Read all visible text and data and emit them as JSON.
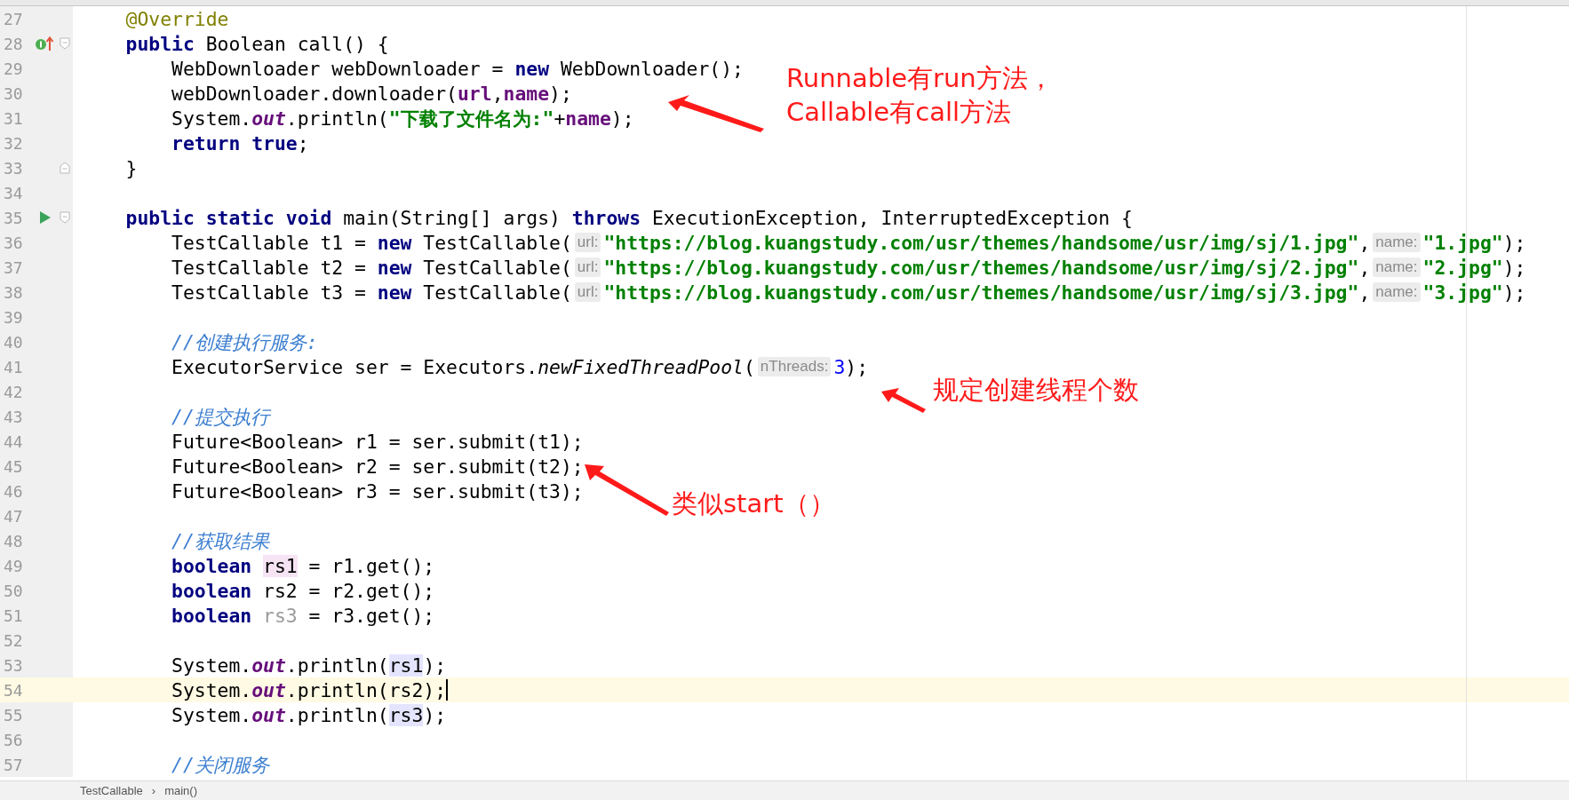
{
  "editor": {
    "lines": [
      {
        "number": "27",
        "current": false,
        "tokens": [
          {
            "kind": "annotation",
            "text": "    @Override"
          }
        ]
      },
      {
        "number": "28",
        "current": false,
        "marker": {
          "kind": "implements"
        },
        "fold": {
          "kind": "start"
        },
        "tokens": [
          {
            "kind": "keyword",
            "text": "    public"
          },
          {
            "kind": "text",
            "text": " Boolean call() {"
          }
        ]
      },
      {
        "number": "29",
        "current": false,
        "tokens": [
          {
            "kind": "text",
            "text": "        WebDownloader webDownloader = "
          },
          {
            "kind": "keyword",
            "text": "new"
          },
          {
            "kind": "text",
            "text": " WebDownloader();"
          }
        ]
      },
      {
        "number": "30",
        "current": false,
        "tokens": [
          {
            "kind": "text",
            "text": "        webDownloader.downloader("
          },
          {
            "kind": "field",
            "text": "url"
          },
          {
            "kind": "text",
            "text": ","
          },
          {
            "kind": "field",
            "text": "name"
          },
          {
            "kind": "text",
            "text": ");"
          }
        ]
      },
      {
        "number": "31",
        "current": false,
        "tokens": [
          {
            "kind": "text",
            "text": "        System."
          },
          {
            "kind": "static",
            "text": "out"
          },
          {
            "kind": "text",
            "text": ".println("
          },
          {
            "kind": "string",
            "text": "\"下载了文件名为:\""
          },
          {
            "kind": "text",
            "text": "+"
          },
          {
            "kind": "field",
            "text": "name"
          },
          {
            "kind": "text",
            "text": ");"
          }
        ]
      },
      {
        "number": "32",
        "current": false,
        "tokens": [
          {
            "kind": "keyword",
            "text": "        return true"
          },
          {
            "kind": "text",
            "text": ";"
          }
        ]
      },
      {
        "number": "33",
        "current": false,
        "fold": {
          "kind": "end"
        },
        "tokens": [
          {
            "kind": "text",
            "text": "    }"
          }
        ]
      },
      {
        "number": "34",
        "current": false
      },
      {
        "number": "35",
        "current": false,
        "marker": {
          "kind": "run"
        },
        "fold": {
          "kind": "start"
        },
        "tokens": [
          {
            "kind": "keyword",
            "text": "    public static void"
          },
          {
            "kind": "text",
            "text": " main(String[] args) "
          },
          {
            "kind": "keyword",
            "text": "throws"
          },
          {
            "kind": "text",
            "text": " ExecutionException, InterruptedException {"
          }
        ]
      },
      {
        "number": "36",
        "current": false,
        "tokens": [
          {
            "kind": "text",
            "text": "        TestCallable t1 = "
          },
          {
            "kind": "keyword",
            "text": "new"
          },
          {
            "kind": "text",
            "text": " TestCallable("
          },
          {
            "kind": "hint",
            "text": "url:"
          },
          {
            "kind": "string",
            "text": "\"https://blog.kuangstudy.com/usr/themes/handsome/usr/img/sj/1.jpg\""
          },
          {
            "kind": "text",
            "text": ","
          },
          {
            "kind": "hint",
            "text": "name:"
          },
          {
            "kind": "string",
            "text": "\"1.jpg\""
          },
          {
            "kind": "text",
            "text": ");"
          }
        ]
      },
      {
        "number": "37",
        "current": false,
        "tokens": [
          {
            "kind": "text",
            "text": "        TestCallable t2 = "
          },
          {
            "kind": "keyword",
            "text": "new"
          },
          {
            "kind": "text",
            "text": " TestCallable("
          },
          {
            "kind": "hint",
            "text": "url:"
          },
          {
            "kind": "string",
            "text": "\"https://blog.kuangstudy.com/usr/themes/handsome/usr/img/sj/2.jpg\""
          },
          {
            "kind": "text",
            "text": ","
          },
          {
            "kind": "hint",
            "text": "name:"
          },
          {
            "kind": "string",
            "text": "\"2.jpg\""
          },
          {
            "kind": "text",
            "text": ");"
          }
        ]
      },
      {
        "number": "38",
        "current": false,
        "tokens": [
          {
            "kind": "text",
            "text": "        TestCallable t3 = "
          },
          {
            "kind": "keyword",
            "text": "new"
          },
          {
            "kind": "text",
            "text": " TestCallable("
          },
          {
            "kind": "hint",
            "text": "url:"
          },
          {
            "kind": "string",
            "text": "\"https://blog.kuangstudy.com/usr/themes/handsome/usr/img/sj/3.jpg\""
          },
          {
            "kind": "text",
            "text": ","
          },
          {
            "kind": "hint",
            "text": "name:"
          },
          {
            "kind": "string",
            "text": "\"3.jpg\""
          },
          {
            "kind": "text",
            "text": ");"
          }
        ]
      },
      {
        "number": "39",
        "current": false
      },
      {
        "number": "40",
        "current": false,
        "tokens": [
          {
            "kind": "comment",
            "text": "        //创建执行服务:"
          }
        ]
      },
      {
        "number": "41",
        "current": false,
        "tokens": [
          {
            "kind": "text",
            "text": "        ExecutorService ser = Executors."
          },
          {
            "kind": "italic",
            "text": "newFixedThreadPool"
          },
          {
            "kind": "text",
            "text": "("
          },
          {
            "kind": "hint",
            "text": "nThreads:"
          },
          {
            "kind": "number",
            "text": "3"
          },
          {
            "kind": "text",
            "text": ");"
          }
        ]
      },
      {
        "number": "42",
        "current": false
      },
      {
        "number": "43",
        "current": false,
        "tokens": [
          {
            "kind": "comment",
            "text": "        //提交执行"
          }
        ]
      },
      {
        "number": "44",
        "current": false,
        "tokens": [
          {
            "kind": "text",
            "text": "        Future<Boolean> r1 = ser.submit(t1);"
          }
        ]
      },
      {
        "number": "45",
        "current": false,
        "tokens": [
          {
            "kind": "text",
            "text": "        Future<Boolean> r2 = ser.submit(t2);"
          }
        ]
      },
      {
        "number": "46",
        "current": false,
        "tokens": [
          {
            "kind": "text",
            "text": "        Future<Boolean> r3 = ser.submit(t3);"
          }
        ]
      },
      {
        "number": "47",
        "current": false
      },
      {
        "number": "48",
        "current": false,
        "tokens": [
          {
            "kind": "comment",
            "text": "        //获取结果"
          }
        ]
      },
      {
        "number": "49",
        "current": false,
        "tokens": [
          {
            "kind": "keyword",
            "text": "        boolean "
          },
          {
            "kind": "highlight",
            "text": "rs1"
          },
          {
            "kind": "text",
            "text": " = r1.get();"
          }
        ]
      },
      {
        "number": "50",
        "current": false,
        "tokens": [
          {
            "kind": "keyword",
            "text": "        boolean"
          },
          {
            "kind": "text",
            "text": " rs2 = r2.get();"
          }
        ]
      },
      {
        "number": "51",
        "current": false,
        "tokens": [
          {
            "kind": "keyword",
            "text": "        boolean "
          },
          {
            "kind": "unused",
            "text": "rs3"
          },
          {
            "kind": "text",
            "text": " = r3.get();"
          }
        ]
      },
      {
        "number": "52",
        "current": false
      },
      {
        "number": "53",
        "current": false,
        "tokens": [
          {
            "kind": "text",
            "text": "        System."
          },
          {
            "kind": "static",
            "text": "out"
          },
          {
            "kind": "text",
            "text": ".println("
          },
          {
            "kind": "usage",
            "text": "rs1"
          },
          {
            "kind": "text",
            "text": ");"
          }
        ]
      },
      {
        "number": "54",
        "current": true,
        "tokens": [
          {
            "kind": "text",
            "text": "        System."
          },
          {
            "kind": "static",
            "text": "out"
          },
          {
            "kind": "text",
            "text": ".println(rs2);"
          }
        ]
      },
      {
        "number": "55",
        "current": false,
        "tokens": [
          {
            "kind": "text",
            "text": "        System."
          },
          {
            "kind": "static",
            "text": "out"
          },
          {
            "kind": "text",
            "text": ".println("
          },
          {
            "kind": "usage",
            "text": "rs3"
          },
          {
            "kind": "text",
            "text": ");"
          }
        ]
      },
      {
        "number": "56",
        "current": false
      },
      {
        "number": "57",
        "current": false,
        "tokens": [
          {
            "kind": "comment",
            "text": "        //关闭服务"
          }
        ]
      }
    ]
  },
  "annotations": [
    {
      "lines": [
        "Runnable有run方法，",
        "Callable有call方法"
      ]
    },
    {
      "lines": [
        "规定创建线程个数"
      ]
    },
    {
      "lines": [
        "类似start（）"
      ]
    }
  ],
  "breadcrumb": [
    "TestCallable",
    "›",
    "main()"
  ]
}
